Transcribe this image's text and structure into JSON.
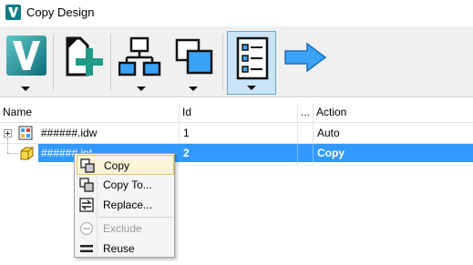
{
  "window": {
    "title": "Copy Design"
  },
  "toolbar": {
    "buttons": [
      {
        "name": "autodesk-menu",
        "icon": "autodesk-v-logo-icon",
        "has_dropdown": true
      },
      {
        "name": "add-files",
        "icon": "add-document-icon",
        "has_dropdown": false
      },
      {
        "name": "hierarchy-view",
        "icon": "hierarchy-icon",
        "has_dropdown": true
      },
      {
        "name": "copy-options",
        "icon": "overlap-squares-icon",
        "has_dropdown": true
      },
      {
        "name": "list-view",
        "icon": "list-icon",
        "has_dropdown": true,
        "active": true
      },
      {
        "name": "next",
        "icon": "right-arrow-icon",
        "has_dropdown": false
      }
    ]
  },
  "grid": {
    "columns": [
      "Name",
      "Id",
      "...",
      "Action"
    ],
    "rows": [
      {
        "name": "######.idw",
        "id": "1",
        "action": "Auto",
        "icon": "drawing-icon",
        "selected": false
      },
      {
        "name": "######.ipt",
        "id": "2",
        "action": "Copy",
        "icon": "part-icon",
        "selected": true
      }
    ]
  },
  "context_menu": {
    "items": [
      {
        "label": "Copy",
        "icon": "copy-icon",
        "highlighted": true,
        "enabled": true
      },
      {
        "label": "Copy To...",
        "icon": "copy-to-icon",
        "highlighted": false,
        "enabled": true
      },
      {
        "label": "Replace...",
        "icon": "replace-icon",
        "highlighted": false,
        "enabled": true
      },
      {
        "label": "Exclude",
        "icon": "exclude-icon",
        "highlighted": false,
        "enabled": false
      },
      {
        "label": "Reuse",
        "icon": "reuse-icon",
        "highlighted": false,
        "enabled": true
      }
    ]
  },
  "colors": {
    "selection": "#3399ff",
    "toolbar_blue": "#3ba3f5",
    "add_green": "#1f9b87",
    "menu_highlight": "#fbf4d8"
  }
}
